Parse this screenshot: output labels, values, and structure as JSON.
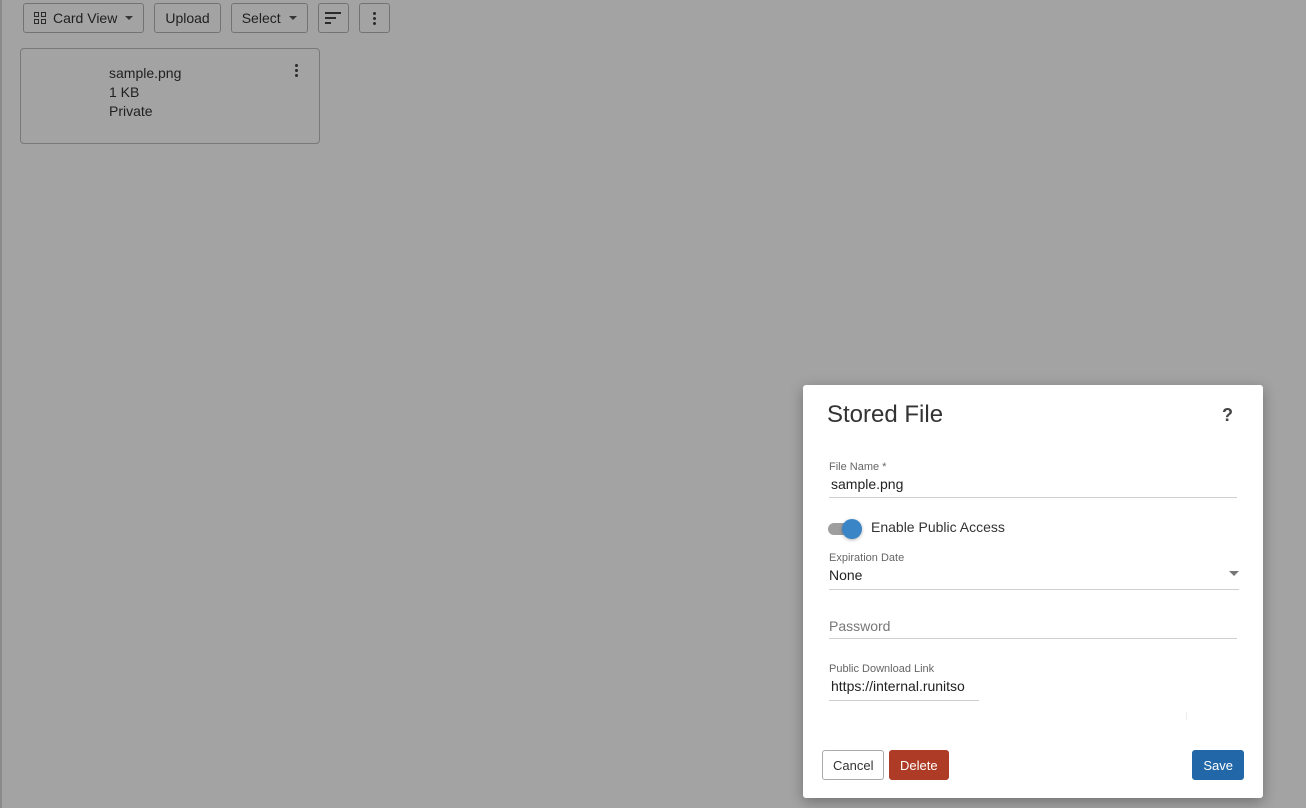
{
  "toolbar": {
    "view_label": "Card View",
    "upload_label": "Upload",
    "select_label": "Select"
  },
  "card": {
    "name": "sample.png",
    "size": "1 KB",
    "access": "Private"
  },
  "dialog": {
    "title": "Stored File",
    "help": "?",
    "file_name_label": "File Name *",
    "file_name_value": "sample.png",
    "public_access_label": "Enable Public Access",
    "public_access_enabled": true,
    "expiration_label": "Expiration Date",
    "expiration_value": "None",
    "password_placeholder": "Password",
    "download_link_label": "Public Download Link",
    "download_link_value": "https://internal.runitso",
    "cancel_label": "Cancel",
    "delete_label": "Delete",
    "save_label": "Save"
  },
  "colors": {
    "accent": "#3a85c6",
    "save": "#2268a8",
    "delete": "#ad3b25"
  }
}
